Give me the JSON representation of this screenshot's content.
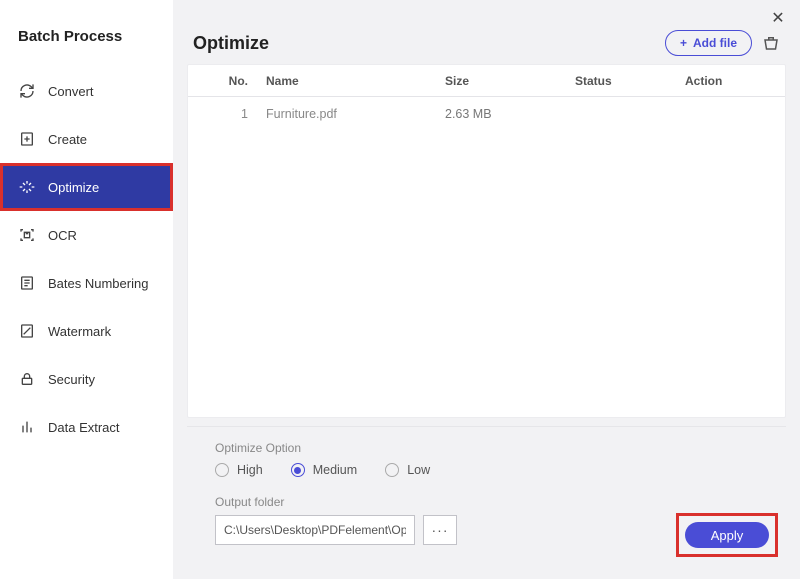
{
  "sidebar": {
    "title": "Batch Process",
    "items": [
      {
        "label": "Convert",
        "icon": "refresh-icon"
      },
      {
        "label": "Create",
        "icon": "new-doc-icon"
      },
      {
        "label": "Optimize",
        "icon": "optimize-icon",
        "active": true
      },
      {
        "label": "OCR",
        "icon": "ocr-icon"
      },
      {
        "label": "Bates Numbering",
        "icon": "bates-icon"
      },
      {
        "label": "Watermark",
        "icon": "watermark-icon"
      },
      {
        "label": "Security",
        "icon": "lock-icon"
      },
      {
        "label": "Data Extract",
        "icon": "data-extract-icon"
      }
    ]
  },
  "header": {
    "title": "Optimize",
    "add_file_label": "Add file"
  },
  "table": {
    "headers": {
      "no": "No.",
      "name": "Name",
      "size": "Size",
      "status": "Status",
      "action": "Action"
    },
    "rows": [
      {
        "no": "1",
        "name": "Furniture.pdf",
        "size": "2.63 MB",
        "status": "",
        "action": ""
      }
    ]
  },
  "optimize": {
    "section_label": "Optimize Option",
    "options": {
      "high": "High",
      "medium": "Medium",
      "low": "Low"
    },
    "selected": "medium"
  },
  "output": {
    "label": "Output folder",
    "path": "C:\\Users\\Desktop\\PDFelement\\Optimize",
    "browse_label": "···"
  },
  "actions": {
    "apply_label": "Apply"
  }
}
